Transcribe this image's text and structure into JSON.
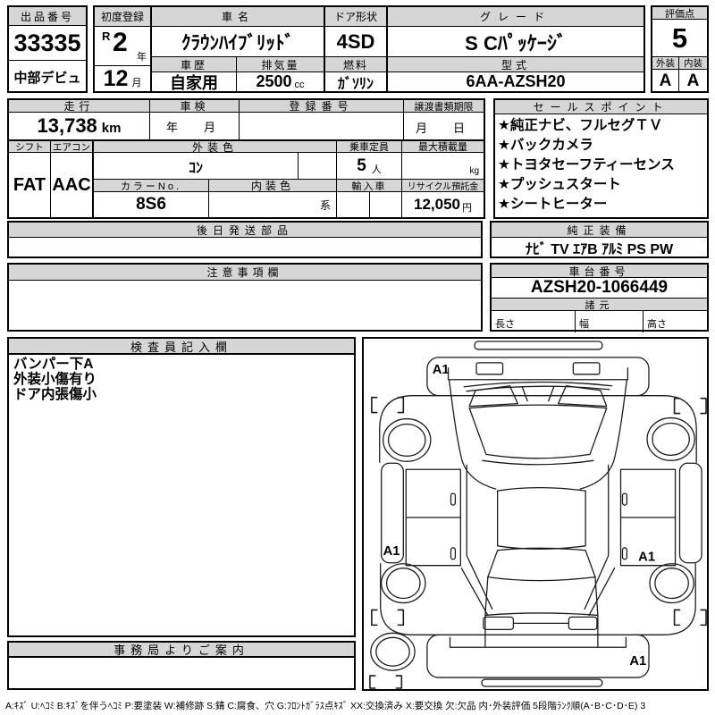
{
  "colors": {
    "header_bg": "#d6d6d6",
    "border": "#000000",
    "paper": "#ffffff"
  },
  "header": {
    "lot_label": "出品番号",
    "lot_number": "33335",
    "venue": "中部デビュ",
    "first_reg_label": "初度登録",
    "era": "R",
    "year": "2",
    "year_unit": "年",
    "month": "12",
    "month_unit": "月",
    "car_name_label": "車名",
    "car_name": "ｸﾗｳﾝﾊｲﾌﾞﾘｯﾄﾞ",
    "history_label": "車歴",
    "history": "自家用",
    "displacement_label": "排気量",
    "displacement": "2500",
    "displacement_unit": "cc",
    "door_label": "ドア形状",
    "door": "4SD",
    "fuel_label": "燃料",
    "fuel": "ｶﾞｿﾘﾝ",
    "grade_label": "グレード",
    "grade": "S Cﾊﾟｯｹｰｼﾞ",
    "model_label": "型式",
    "model": "6AA-AZSH20",
    "score_label": "評価点",
    "score": "5",
    "exterior_label": "外装",
    "exterior_grade": "A",
    "interior_label": "内装",
    "interior_grade": "A"
  },
  "row2": {
    "mileage_label": "走行",
    "mileage": "13,738",
    "mileage_unit": "km",
    "inspection_label": "車検",
    "inspection": "年　月",
    "reg_no_label": "登録番号",
    "reg_no": "",
    "transfer_label": "譲渡書類期限",
    "transfer": "月　日",
    "shift_label": "シフト",
    "shift": "FAT",
    "aircon_label": "エアコン",
    "aircon": "AAC",
    "ext_color_label": "外装色",
    "ext_color": "ｺﾝ",
    "capacity_label": "乗車定員",
    "capacity": "5",
    "capacity_unit": "人",
    "max_load_label": "最大積載量",
    "max_load": "",
    "max_load_unit": "kg",
    "color_no_label": "カラーNo.",
    "color_no": "8S6",
    "int_color_label": "内装色",
    "int_color": "",
    "int_color_suffix": "系",
    "import_label": "輸入車",
    "import_value": "",
    "recycle_label": "リサイクル預託金",
    "recycle_fee": "12,050",
    "recycle_unit": "円"
  },
  "sales": {
    "label": "セールスポイント",
    "items": [
      "★純正ナビ、フルセグＴＶ",
      "★バックカメラ",
      "★トヨタセーフティーセンス",
      "★プッシュスタート",
      "★シートヒーター"
    ]
  },
  "later_parts": {
    "label": "後日発送部品",
    "value": ""
  },
  "oem": {
    "label": "純正装備",
    "value": "ﾅﾋﾞ TV ｴｱB ｱﾙﾐ PS PW"
  },
  "notes": {
    "label": "注意事項欄",
    "value": ""
  },
  "chassis": {
    "label": "車台番号",
    "number": "AZSH20-1066449"
  },
  "dims": {
    "label": "諸元",
    "length_label": "長さ",
    "length": "",
    "width_label": "幅",
    "width": "",
    "height_label": "高さ",
    "height": ""
  },
  "inspector": {
    "label": "検査員記入欄",
    "lines": [
      "バンパー下A",
      "外装小傷有り",
      "ドア内張傷小"
    ]
  },
  "office": {
    "label": "事務局よりご案内",
    "value": ""
  },
  "diagram": {
    "marks": [
      {
        "label": "A1",
        "position": "front-bumper"
      },
      {
        "label": "A1",
        "position": "left-rocker"
      },
      {
        "label": "A1",
        "position": "right-rear-door"
      },
      {
        "label": "A1",
        "position": "rear-bumper"
      }
    ]
  },
  "legend": "A:ｷｽﾞ U:ﾍｺﾐ B:ｷｽﾞを伴うﾍｺﾐ P:要塗装 W:補修跡 S:錆 C:腐食、穴 G:ﾌﾛﾝﾄｶﾞﾗｽ点ｷｽﾞ XX:交換済み X:要交換 欠:欠品 内･外装評価 5段階ﾗﾝｸ順(A･B･C･D･E) 3"
}
